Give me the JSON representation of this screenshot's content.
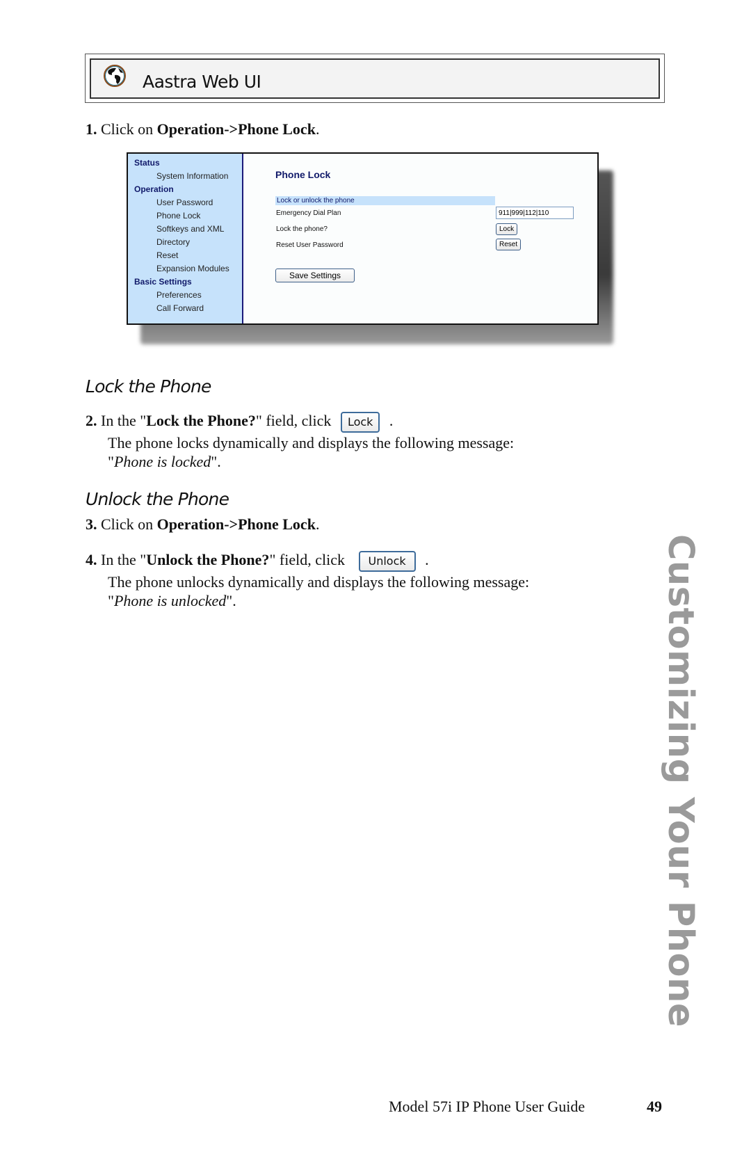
{
  "banner": {
    "icon": "globe-icon",
    "title": "Aastra Web UI"
  },
  "steps": {
    "s1": {
      "num": "1.",
      "pre": "Click on ",
      "bold": "Operation->Phone Lock",
      "post": "."
    },
    "s2": {
      "num": "2.",
      "pre": "In the \"",
      "bold": "Lock the Phone?",
      "post": "\" field, click",
      "button": "Lock",
      "end": ".",
      "desc": "The phone locks dynamically and displays the following message:",
      "msg_open": "\"",
      "msg": "Phone is locked",
      "msg_close": "\"."
    },
    "s3": {
      "num": "3.",
      "pre": "Click on ",
      "bold": "Operation->Phone Lock",
      "post": "."
    },
    "s4": {
      "num": "4.",
      "pre": "In the \"",
      "bold": "Unlock the Phone?",
      "post": "\" field, click",
      "button": "Unlock",
      "end": ".",
      "desc": "The phone unlocks dynamically and displays the following message:",
      "msg_open": "\"",
      "msg": "Phone is unlocked",
      "msg_close": "\"."
    }
  },
  "sections": {
    "lock": "Lock the Phone",
    "unlock": "Unlock the Phone"
  },
  "screenshot": {
    "nav": [
      {
        "type": "head",
        "label": "Status"
      },
      {
        "type": "item",
        "label": "System Information"
      },
      {
        "type": "head",
        "label": "Operation"
      },
      {
        "type": "item",
        "label": "User Password"
      },
      {
        "type": "item",
        "label": "Phone Lock"
      },
      {
        "type": "item",
        "label": "Softkeys and XML"
      },
      {
        "type": "item",
        "label": "Directory"
      },
      {
        "type": "item",
        "label": "Reset"
      },
      {
        "type": "item",
        "label": "Expansion Modules"
      },
      {
        "type": "head",
        "label": "Basic Settings"
      },
      {
        "type": "item",
        "label": "Preferences"
      },
      {
        "type": "item",
        "label": "Call Forward"
      }
    ],
    "title": "Phone Lock",
    "section_bar": "Lock or unlock the phone",
    "rows": {
      "dial_label": "Emergency Dial Plan",
      "dial_value": "911|999|112|110",
      "lock_label": "Lock the phone?",
      "lock_button": "Lock",
      "reset_label": "Reset User Password",
      "reset_button": "Reset"
    },
    "save_button": "Save Settings",
    "colors": {
      "nav_bg": "#c6e2fb",
      "title": "#111a6a"
    }
  },
  "side_tab": "Customizing Your Phone",
  "footer": {
    "title": "Model 57i IP Phone User Guide",
    "page": "49"
  }
}
